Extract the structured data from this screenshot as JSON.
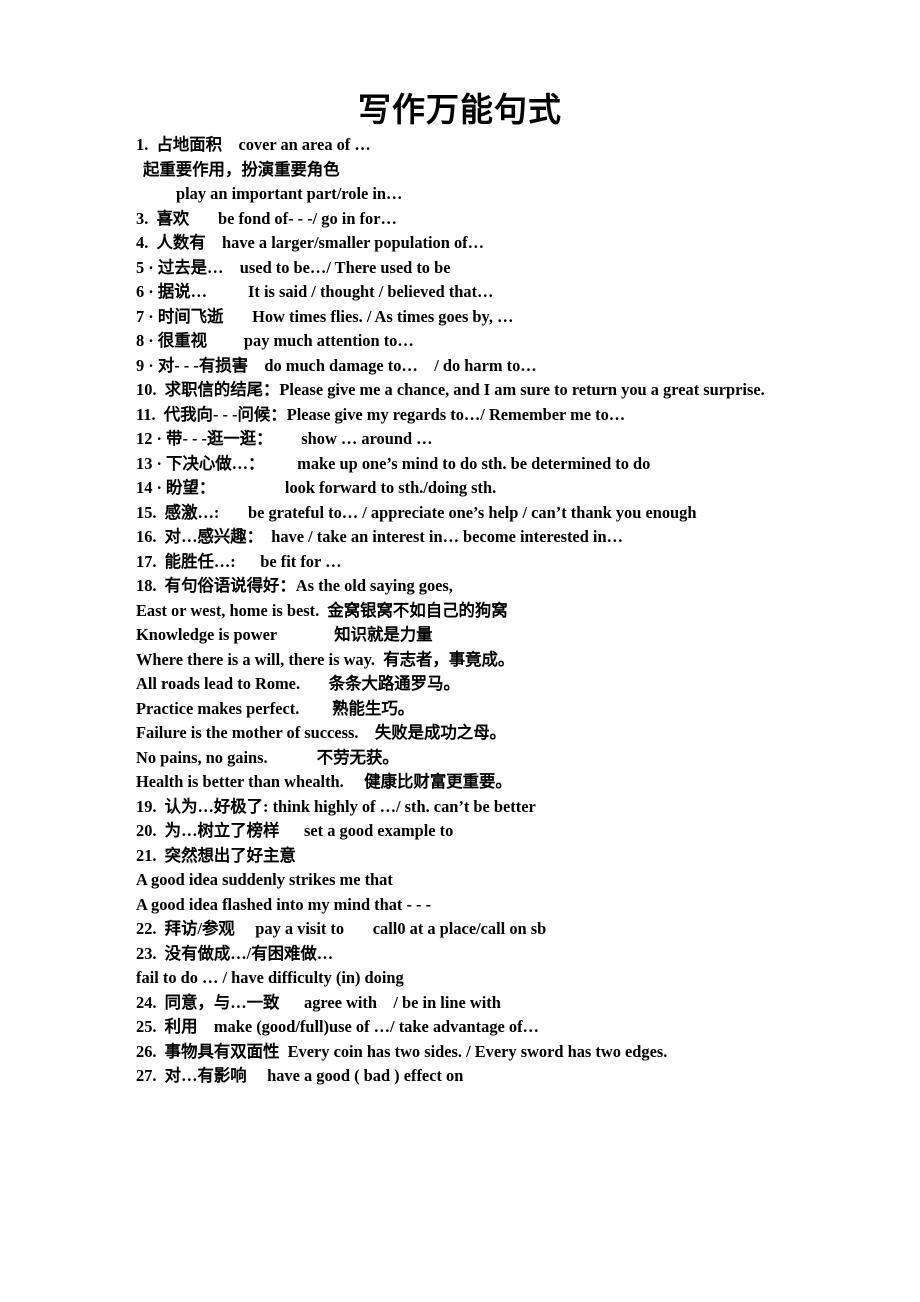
{
  "document": {
    "title": "写作万能句式",
    "background_color": "#ffffff",
    "text_color": "#000000"
  },
  "lines": [
    {
      "id": "item-1",
      "text": "1.  占地面积    cover an area of …",
      "indent": 0
    },
    {
      "id": "item-1b",
      "text": "起重要作用，扮演重要角色",
      "indent": 1
    },
    {
      "id": "item-1c",
      "text": "play an important part/role in…",
      "indent": 2
    },
    {
      "id": "item-3",
      "text": "3.  喜欢       be fond of- - -/ go in for…",
      "indent": 0
    },
    {
      "id": "item-4",
      "text": "4.  人数有    have a larger/smaller population of…",
      "indent": 0
    },
    {
      "id": "item-5",
      "text": "5 · 过去是…    used to be…/ There used to be",
      "indent": 0
    },
    {
      "id": "item-6",
      "text": "6 · 据说…          It is said / thought / believed that…",
      "indent": 0
    },
    {
      "id": "item-7",
      "text": "7 · 时间飞逝       How times flies. / As times goes by, …",
      "indent": 0
    },
    {
      "id": "item-8",
      "text": "8 · 很重视         pay much attention to…",
      "indent": 0
    },
    {
      "id": "item-9",
      "text": "9 · 对- - -有损害    do much damage to…    / do harm to…",
      "indent": 0
    },
    {
      "id": "item-10",
      "text": "10.  求职信的结尾：Please give me a chance, and I am sure to return you a great surprise.",
      "indent": 0
    },
    {
      "id": "item-11",
      "text": "11.  代我向- - -问候：Please give my regards to…/ Remember me to…",
      "indent": 0
    },
    {
      "id": "item-12",
      "text": "12 · 带- - -逛一逛：       show … around …",
      "indent": 0
    },
    {
      "id": "item-13",
      "text": "13 · 下决心做…：        make up one’s mind to do sth. be determined to do",
      "indent": 0
    },
    {
      "id": "item-14",
      "text": "14 · 盼望：                 look forward to sth./doing sth.",
      "indent": 0
    },
    {
      "id": "item-15",
      "text": "15.  感激…:       be grateful to… / appreciate one’s help / can’t thank you enough",
      "indent": 0
    },
    {
      "id": "item-16",
      "text": "16.  对…感兴趣：  have / take an interest in… become interested in…",
      "indent": 0
    },
    {
      "id": "item-17",
      "text": "17.  能胜任…:      be fit for …",
      "indent": 0
    },
    {
      "id": "item-18",
      "text": "18.  有句俗语说得好：As the old saying goes,",
      "indent": 0
    },
    {
      "id": "proverb-1",
      "text": "East or west, home is best.  金窝银窝不如自己的狗窝",
      "indent": 0
    },
    {
      "id": "proverb-2",
      "text": "Knowledge is power              知识就是力量",
      "indent": 0
    },
    {
      "id": "proverb-3",
      "text": "Where there is a will, there is way.  有志者，事竟成。",
      "indent": 0
    },
    {
      "id": "proverb-4",
      "text": "All roads lead to Rome.       条条大路通罗马。",
      "indent": 0
    },
    {
      "id": "proverb-5",
      "text": "Practice makes perfect.        熟能生巧。",
      "indent": 0
    },
    {
      "id": "proverb-6",
      "text": "Failure is the mother of success.    失败是成功之母。",
      "indent": 0
    },
    {
      "id": "proverb-7",
      "text": "No pains, no gains.            不劳无获。",
      "indent": 0
    },
    {
      "id": "proverb-8",
      "text": "Health is better than whealth.     健康比财富更重要。",
      "indent": 0
    },
    {
      "id": "item-19",
      "text": "19.  认为…好极了: think highly of …/ sth. can’t be better",
      "indent": 0
    },
    {
      "id": "item-20",
      "text": "20.  为…树立了榜样      set a good example to",
      "indent": 0
    },
    {
      "id": "item-21",
      "text": "21.  突然想出了好主意",
      "indent": 0
    },
    {
      "id": "item-21b",
      "text": "A good idea suddenly strikes me that",
      "indent": 0
    },
    {
      "id": "item-21c",
      "text": "A good idea flashed into my mind that - - -",
      "indent": 0
    },
    {
      "id": "item-22",
      "text": "22.  拜访/参观     pay a visit to       call0 at a place/call on sb",
      "indent": 0
    },
    {
      "id": "item-23",
      "text": "23.  没有做成…/有困难做…",
      "indent": 0
    },
    {
      "id": "item-23b",
      "text": "fail to do … / have difficulty (in) doing",
      "indent": 0
    },
    {
      "id": "item-24",
      "text": "24.  同意，与…一致      agree with    / be in line with",
      "indent": 0
    },
    {
      "id": "item-25",
      "text": "25.  利用    make (good/full)use of …/ take advantage of…",
      "indent": 0
    },
    {
      "id": "item-26",
      "text": "26.  事物具有双面性  Every coin has two sides. / Every sword has two edges.",
      "indent": 0
    },
    {
      "id": "item-27",
      "text": "27.  对…有影响     have a good ( bad ) effect on",
      "indent": 0
    }
  ]
}
